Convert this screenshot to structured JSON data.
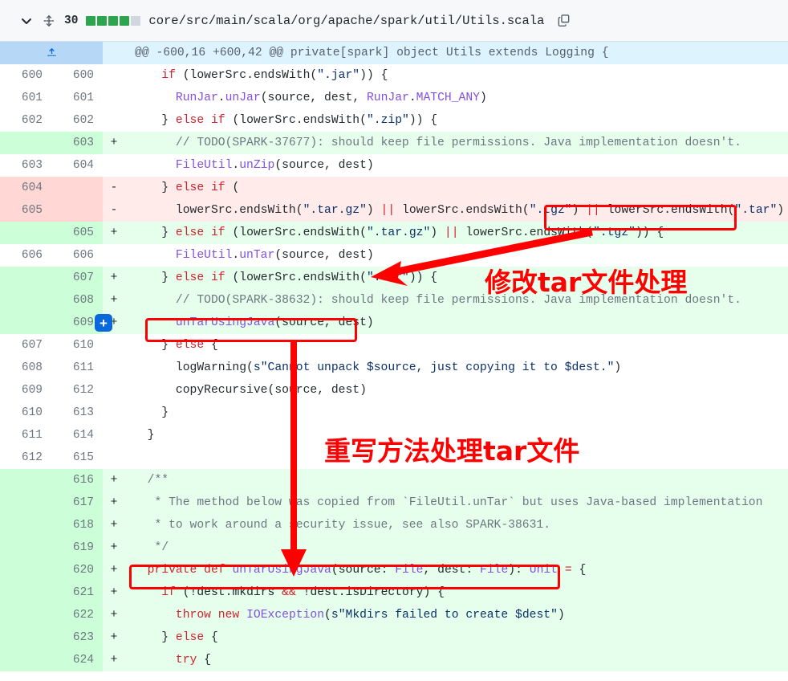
{
  "header": {
    "chevron_icon": "chevron-down-icon",
    "move_icon": "move-diff-icon",
    "changes_count": "30",
    "diffstat_blocks": [
      "#2da44e",
      "#2da44e",
      "#2da44e",
      "#2da44e",
      "#d0d7de"
    ],
    "file_path": "core/src/main/scala/org/apache/spark/util/Utils.scala",
    "copy_icon": "copy-icon"
  },
  "hunk": {
    "expand_icon": "expand-up-icon",
    "text": "@@ -600,16 +600,42 @@ private[spark] object Utils extends Logging {"
  },
  "colors": {
    "addition_bg": "#e6ffec",
    "addition_gutter": "#ccffd8",
    "deletion_bg": "#ffebe9",
    "deletion_gutter": "#ffd7d5",
    "hunk_bg": "#ddf4ff",
    "hunk_gutter": "#b6d7f5",
    "annotation": "#ff0000",
    "add_button": "#0969da"
  },
  "rows": [
    {
      "type": "ctx",
      "old": "600",
      "new": "600",
      "sign": "",
      "code": "    if (lowerSrc.endsWith(\".jar\")) {"
    },
    {
      "type": "ctx",
      "old": "601",
      "new": "601",
      "sign": "",
      "code": "      RunJar.unJar(source, dest, RunJar.MATCH_ANY)"
    },
    {
      "type": "ctx",
      "old": "602",
      "new": "602",
      "sign": "",
      "code": "    } else if (lowerSrc.endsWith(\".zip\")) {"
    },
    {
      "type": "add",
      "old": "",
      "new": "603",
      "sign": "+",
      "code": "      // TODO(SPARK-37677): should keep file permissions. Java implementation doesn't."
    },
    {
      "type": "ctx",
      "old": "603",
      "new": "604",
      "sign": "",
      "code": "      FileUtil.unZip(source, dest)"
    },
    {
      "type": "del",
      "old": "604",
      "new": "",
      "sign": "-",
      "code": "    } else if ("
    },
    {
      "type": "del",
      "old": "605",
      "new": "",
      "sign": "-",
      "code": "      lowerSrc.endsWith(\".tar.gz\") || lowerSrc.endsWith(\".tgz\") || lowerSrc.endsWith(\".tar\") {"
    },
    {
      "type": "add",
      "old": "",
      "new": "605",
      "sign": "+",
      "code": "    } else if (lowerSrc.endsWith(\".tar.gz\") || lowerSrc.endsWith(\".tgz\")) {"
    },
    {
      "type": "ctx",
      "old": "606",
      "new": "606",
      "sign": "",
      "code": "      FileUtil.unTar(source, dest)"
    },
    {
      "type": "add",
      "old": "",
      "new": "607",
      "sign": "+",
      "code": "    } else if (lowerSrc.endsWith(\".tar\")) {"
    },
    {
      "type": "add",
      "old": "",
      "new": "608",
      "sign": "+",
      "code": "      // TODO(SPARK-38632): should keep file permissions. Java implementation doesn't."
    },
    {
      "type": "add",
      "old": "",
      "new": "609",
      "sign": "+",
      "code": "      unTarUsingJava(source, dest)",
      "add_button": true
    },
    {
      "type": "ctx",
      "old": "607",
      "new": "610",
      "sign": "",
      "code": "    } else {"
    },
    {
      "type": "ctx",
      "old": "608",
      "new": "611",
      "sign": "",
      "code": "      logWarning(s\"Cannot unpack $source, just copying it to $dest.\")"
    },
    {
      "type": "ctx",
      "old": "609",
      "new": "612",
      "sign": "",
      "code": "      copyRecursive(source, dest)"
    },
    {
      "type": "ctx",
      "old": "610",
      "new": "613",
      "sign": "",
      "code": "    }"
    },
    {
      "type": "ctx",
      "old": "611",
      "new": "614",
      "sign": "",
      "code": "  }"
    },
    {
      "type": "ctx",
      "old": "612",
      "new": "615",
      "sign": "",
      "code": ""
    },
    {
      "type": "add",
      "old": "",
      "new": "616",
      "sign": "+",
      "code": "  /**"
    },
    {
      "type": "add",
      "old": "",
      "new": "617",
      "sign": "+",
      "code": "   * The method below was copied from `FileUtil.unTar` but uses Java-based implementation"
    },
    {
      "type": "add",
      "old": "",
      "new": "618",
      "sign": "+",
      "code": "   * to work around a security issue, see also SPARK-38631."
    },
    {
      "type": "add",
      "old": "",
      "new": "619",
      "sign": "+",
      "code": "   */"
    },
    {
      "type": "add",
      "old": "",
      "new": "620",
      "sign": "+",
      "code": "  private def unTarUsingJava(source: File, dest: File): Unit = {"
    },
    {
      "type": "add",
      "old": "",
      "new": "621",
      "sign": "+",
      "code": "    if (!dest.mkdirs && !dest.isDirectory) {"
    },
    {
      "type": "add",
      "old": "",
      "new": "622",
      "sign": "+",
      "code": "      throw new IOException(s\"Mkdirs failed to create $dest\")"
    },
    {
      "type": "add",
      "old": "",
      "new": "623",
      "sign": "+",
      "code": "    } else {"
    },
    {
      "type": "add",
      "old": "",
      "new": "624",
      "sign": "+",
      "code": "      try {"
    }
  ],
  "annotations": {
    "label_1": "修改tar文件处理",
    "label_2": "重写方法处理tar文件"
  }
}
